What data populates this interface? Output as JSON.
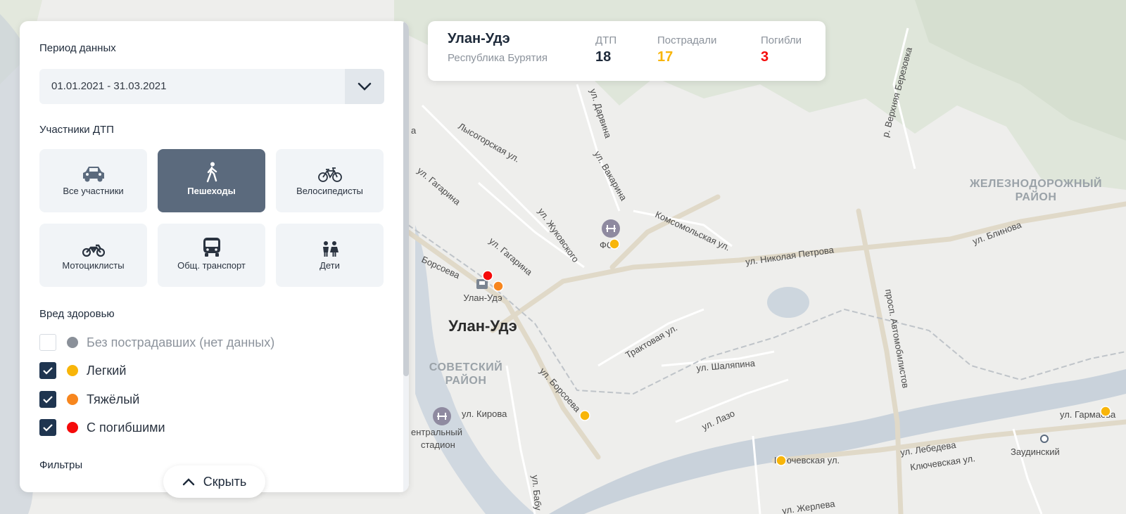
{
  "map": {
    "city_label": "Улан-Удэ",
    "station_label": "Улан-Удэ",
    "districts": [
      "СОВЕТСКИЙ",
      "РАЙОН",
      "ЖЕЛЕЗНОДОРОЖНЫЙ",
      "РАЙОН"
    ],
    "streets": [
      "Лысогорская ул.",
      "ул. Дарвина",
      "ул. Вакарина",
      "ул. Жуковского",
      "ул. Гагарина",
      "ул. Гагарина",
      "Комсомольская ул.",
      "ул. Николая Петрова",
      "ул. Блинова",
      "р. Верхняя Березовка",
      "просп. Автомобилистов",
      "Трактовая ул.",
      "ул. Шаляпина",
      "ул. Борсоева",
      "Борсоева",
      "ул. Кирова",
      "ул. Лазо",
      "Ключевская ул.",
      "Ключевская ул.",
      "ул. Лебедева",
      "ул. Гармаева",
      "Заудинский",
      "ул. Бабу",
      "ул. Жерлева",
      "ентральный",
      "стадион",
      "ФСК",
      "а"
    ],
    "incidents": [
      {
        "severity": "fatal",
        "color": "#f50a0a"
      },
      {
        "severity": "severe",
        "color": "#f7861e"
      },
      {
        "severity": "light",
        "color": "#f8b509"
      },
      {
        "severity": "light",
        "color": "#f8b509"
      },
      {
        "severity": "light",
        "color": "#f8b509"
      },
      {
        "severity": "light",
        "color": "#f8b509"
      }
    ]
  },
  "panel": {
    "period_title": "Период данных",
    "period_value": "01.01.2021 - 31.03.2021",
    "participants_title": "Участники ДТП",
    "participants": [
      {
        "label": "Все участники",
        "icon": "car-icon",
        "active": false
      },
      {
        "label": "Пешеходы",
        "icon": "pedestrian-icon",
        "active": true
      },
      {
        "label": "Велосипедисты",
        "icon": "bicycle-icon",
        "active": false
      },
      {
        "label": "Мотоциклисты",
        "icon": "motorcycle-icon",
        "active": false
      },
      {
        "label": "Общ. транспорт",
        "icon": "bus-icon",
        "active": false
      },
      {
        "label": "Дети",
        "icon": "children-icon",
        "active": false
      }
    ],
    "harm_title": "Вред здоровью",
    "harm": [
      {
        "label": "Без пострадавших (нет данных)",
        "checked": false,
        "color": "#8a9099"
      },
      {
        "label": "Легкий",
        "checked": true,
        "color": "#f8b509"
      },
      {
        "label": "Тяжёлый",
        "checked": true,
        "color": "#f7861e"
      },
      {
        "label": "С погибшими",
        "checked": true,
        "color": "#f50a0a"
      }
    ],
    "filters_title": "Фильтры",
    "hide_label": "Скрыть"
  },
  "stats": {
    "city": "Улан-Удэ",
    "region": "Республика Бурятия",
    "items": [
      {
        "label": "ДТП",
        "value": "18",
        "color": "#1e2a3a"
      },
      {
        "label": "Пострадали",
        "value": "17",
        "color": "#f8b509"
      },
      {
        "label": "Погибли",
        "value": "3",
        "color": "#f50a0a"
      }
    ]
  }
}
